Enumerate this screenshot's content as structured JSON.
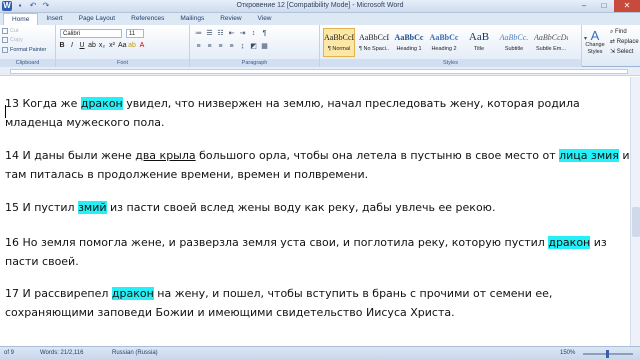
{
  "window": {
    "title": "Откровение 12 [Compatibility Mode] - Microsoft Word",
    "app_icon": "W",
    "controls": [
      "minimize",
      "maximize",
      "close"
    ]
  },
  "tabs": [
    "Home",
    "Insert",
    "Page Layout",
    "References",
    "Mailings",
    "Review",
    "View"
  ],
  "ribbon": {
    "clipboard": {
      "cut": "Cut",
      "copy": "Copy",
      "format_painter": "Format Painter",
      "label": "Clipboard"
    },
    "font": {
      "name": "Calibri",
      "size": "11",
      "label": "Font"
    },
    "paragraph": {
      "label": "Paragraph"
    },
    "styles": {
      "label": "Styles",
      "items": [
        {
          "preview": "AaBbCcDc",
          "name": "¶ Normal"
        },
        {
          "preview": "AaBbCcDc",
          "name": "¶ No Spaci..."
        },
        {
          "preview": "AaBbCc",
          "name": "Heading 1"
        },
        {
          "preview": "AaBbCc",
          "name": "Heading 2"
        },
        {
          "preview": "AaB",
          "name": "Title"
        },
        {
          "preview": "AaBbCc.",
          "name": "Subtitle"
        },
        {
          "preview": "AaBbCcDc",
          "name": "Subtle Em..."
        }
      ],
      "change_styles": "Change Styles"
    },
    "editing": {
      "find": "Find",
      "replace": "Replace",
      "select": "Select"
    }
  },
  "document": {
    "paragraphs": [
      {
        "lines": [
          [
            {
              "t": "13 Когда же "
            },
            {
              "t": "дракон",
              "hl": true
            },
            {
              "t": " увидел, что низвержен на землю, начал преследовать жену, которая родила"
            }
          ],
          [
            {
              "t": "младенца мужеского пола."
            }
          ]
        ]
      },
      {
        "lines": [
          [
            {
              "t": "14 И даны были жене "
            },
            {
              "t": "два крыла",
              "ul": true
            },
            {
              "t": " большого орла, чтобы она летела в пустыню в свое место от "
            },
            {
              "t": "лица змия",
              "hl": true
            },
            {
              "t": " и"
            }
          ],
          [
            {
              "t": "там питалась в продолжение времени, времен и полвремени."
            }
          ]
        ]
      },
      {
        "lines": [
          [
            {
              "t": "15 И пустил "
            },
            {
              "t": "змий",
              "hl": true
            },
            {
              "t": " из пасти своей вслед жены воду как реку, дабы увлечь ее рекою."
            }
          ]
        ]
      },
      {
        "lines": [
          [
            {
              "t": "16 Но земля помогла жене, и разверзла земля уста свои, и поглотила реку, которую пустил "
            },
            {
              "t": "дракон",
              "hl": true
            },
            {
              "t": " из"
            }
          ],
          [
            {
              "t": "пасти своей."
            }
          ]
        ]
      },
      {
        "lines": [
          [
            {
              "t": "17 И рассвирепел "
            },
            {
              "t": "дракон",
              "hl": true
            },
            {
              "t": " на жену, и пошел, чтобы вступить в брань с прочими от семени ее,"
            }
          ],
          [
            {
              "t": "сохраняющими заповеди Божии и имеющими свидетельство Иисуса Христа."
            }
          ]
        ]
      }
    ]
  },
  "status_bar": {
    "page": "of 9",
    "words": "Words: 21/2,116",
    "language": "Russian (Russia)",
    "zoom": "150%"
  },
  "colors": {
    "highlight": "#25f0f7",
    "ribbon_bg": "#dfe9f6",
    "active_style": "#fde7a6"
  }
}
